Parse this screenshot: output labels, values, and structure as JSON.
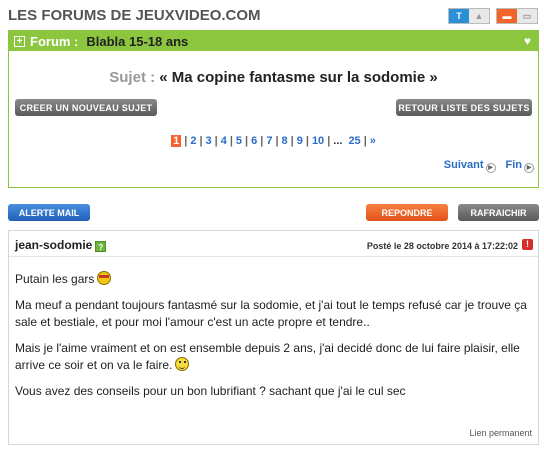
{
  "header": {
    "site_title": "LES FORUMS DE JEUXVIDEO.COM",
    "icon_t_label": "T"
  },
  "forum": {
    "label": "Forum :",
    "name": "Blabla 15-18 ans"
  },
  "topic": {
    "subject_label": "Sujet :",
    "subject_title": "« Ma copine fantasme sur la sodomie »",
    "new_topic_button": "CREER UN NOUVEAU SUJET",
    "back_to_list_button": "RETOUR LISTE DES SUJETS"
  },
  "pagination": {
    "current": "1",
    "pages": [
      "2",
      "3",
      "4",
      "5",
      "6",
      "7",
      "8",
      "9",
      "10"
    ],
    "ellipsis": "...",
    "last": "25",
    "next_symbol": "»",
    "next_label": "Suivant",
    "end_label": "Fin"
  },
  "actions": {
    "alert_button": "ALERTE MAIL",
    "reply_button": "REPONDRE",
    "refresh_button": "RAFRAICHIR"
  },
  "post": {
    "author": "jean-sodomie",
    "date": "Posté le 28 octobre 2014 à 17:22:02",
    "paragraph_1": "Putain les gars",
    "paragraph_2": "Ma meuf a pendant toujours fantasmé sur la sodomie, et j'ai tout le temps refusé car je trouve ça sale et bestiale, et pour moi l'amour c'est un acte propre et tendre..",
    "paragraph_3": "Mais je l'aime vraiment et on est ensemble depuis 2 ans, j'ai decidé donc de lui faire plaisir, elle arrive ce soir et on va le faire.",
    "paragraph_4": "Vous avez des conseils pour un bon lubrifiant ? sachant que j'ai le cul sec",
    "permalink": "Lien permanent"
  },
  "colors": {
    "forum_green": "#8cc63f",
    "accent_orange": "#f2652a",
    "link_blue": "#2b6cc4"
  }
}
